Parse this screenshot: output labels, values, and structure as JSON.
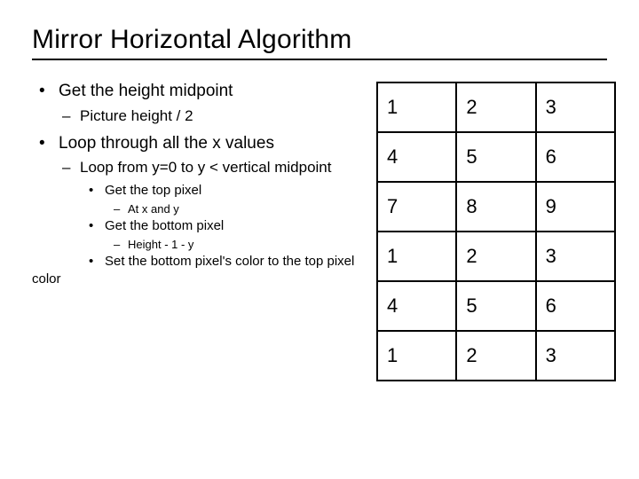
{
  "title": "Mirror Horizontal Algorithm",
  "bullets": {
    "b1_0": "Get the height midpoint",
    "b2_0": "Picture height / 2",
    "b1_1": "Loop through all the x values",
    "b2_1": "Loop from y=0 to y < vertical midpoint",
    "b3_0": "Get the top pixel",
    "b4_0": "At x and y",
    "b3_1": "Get the bottom pixel",
    "b4_1": "Height - 1 - y",
    "b3_2": "Set the bottom pixel's color to the top pixel color"
  },
  "grid": {
    "r0": {
      "c0": "1",
      "c1": "2",
      "c2": "3"
    },
    "r1": {
      "c0": "4",
      "c1": "5",
      "c2": "6"
    },
    "r2": {
      "c0": "7",
      "c1": "8",
      "c2": "9"
    },
    "r3": {
      "c0": "1",
      "c1": "2",
      "c2": "3"
    },
    "r4": {
      "c0": "4",
      "c1": "5",
      "c2": "6"
    },
    "r5": {
      "c0": "1",
      "c1": "2",
      "c2": "3"
    }
  }
}
